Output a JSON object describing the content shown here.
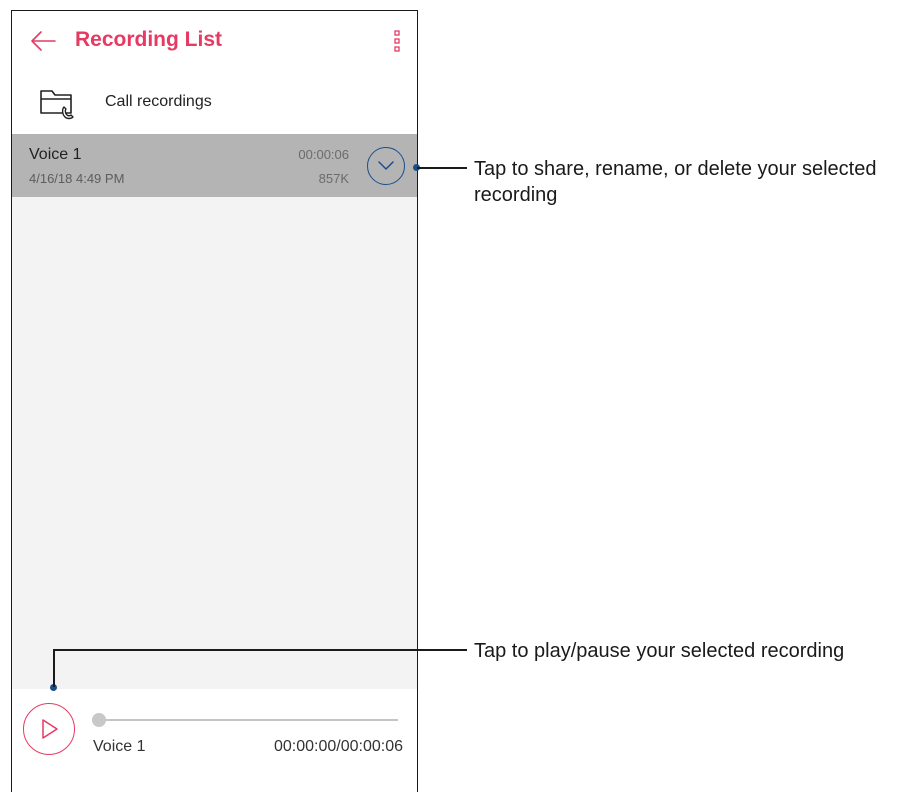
{
  "header": {
    "title": "Recording List",
    "back_icon": "arrow-left-icon",
    "menu_icon": "more-vertical-icon",
    "accent_color": "#e63a63"
  },
  "folder": {
    "label": "Call recordings",
    "icon": "folder-phone-icon"
  },
  "recordings": [
    {
      "name": "Voice 1",
      "date": "4/16/18 4:49 PM",
      "duration": "00:00:06",
      "size": "857K",
      "selected": true,
      "expand_icon": "chevron-down-icon"
    }
  ],
  "player": {
    "track_name": "Voice 1",
    "time": "00:00:00/00:00:06",
    "progress": 0,
    "play_icon": "play-icon"
  },
  "annotations": {
    "expand_note": "Tap to share, rename, or delete your selected recording",
    "play_note": "Tap to play/pause your selected recording"
  }
}
